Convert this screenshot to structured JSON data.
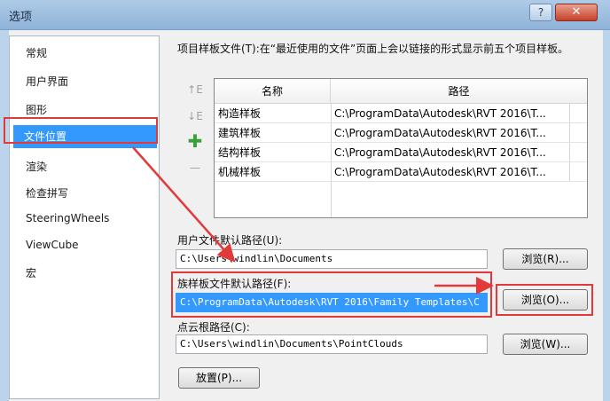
{
  "window": {
    "title": "选项",
    "help_icon": "?",
    "close_icon": "✕"
  },
  "nav": {
    "items": [
      {
        "label": "常规"
      },
      {
        "label": "用户界面"
      },
      {
        "label": "图形"
      },
      {
        "label": "文件位置",
        "selected": true
      },
      {
        "label": "渲染"
      },
      {
        "label": "检查拼写"
      },
      {
        "label": "SteeringWheels"
      },
      {
        "label": "ViewCube"
      },
      {
        "label": "宏"
      }
    ]
  },
  "content": {
    "description": "项目样板文件(T):在“最近使用的文件”页面上会以链接的形式显示前五个项目样板。",
    "side_buttons": {
      "up": "↑E",
      "down": "↓E",
      "add": "✚",
      "remove": "—"
    },
    "table": {
      "headers": [
        "名称",
        "路径"
      ],
      "rows": [
        {
          "name": "构造样板",
          "path": "C:\\ProgramData\\Autodesk\\RVT 2016\\T..."
        },
        {
          "name": "建筑样板",
          "path": "C:\\ProgramData\\Autodesk\\RVT 2016\\T..."
        },
        {
          "name": "结构样板",
          "path": "C:\\ProgramData\\Autodesk\\RVT 2016\\T..."
        },
        {
          "name": "机械样板",
          "path": "C:\\ProgramData\\Autodesk\\RVT 2016\\T..."
        }
      ]
    },
    "user_path": {
      "label": "用户文件默认路径(U):",
      "value": "C:\\Users\\windlin\\Documents",
      "browse": "浏览(R)..."
    },
    "family_path": {
      "label": "族样板文件默认路径(F):",
      "value": "C:\\ProgramData\\Autodesk\\RVT 2016\\Family Templates\\C",
      "browse": "浏览(O)..."
    },
    "cloud_path": {
      "label": "点云根路径(C):",
      "value": "C:\\Users\\windlin\\Documents\\PointClouds",
      "browse": "浏览(W)..."
    },
    "places_button": "放置(P)..."
  },
  "colors": {
    "highlight": "#e23a3a",
    "selection": "#3399ff"
  }
}
